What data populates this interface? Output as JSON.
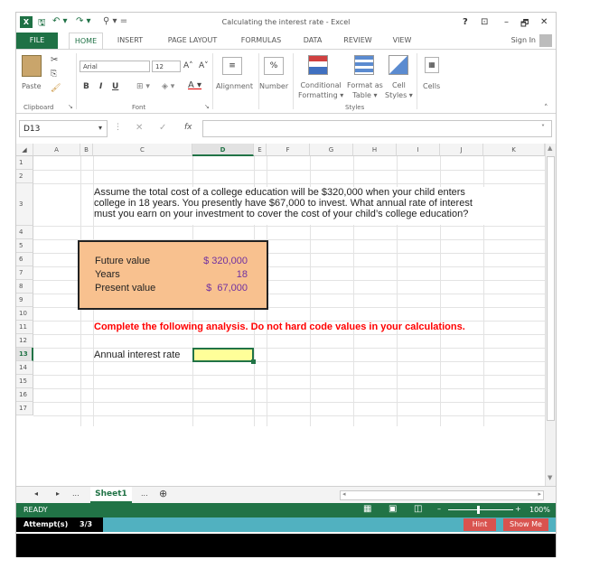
{
  "window": {
    "title": "Calculating the interest rate - Excel",
    "help": "?",
    "controls": [
      "⊡",
      "–",
      "🗗",
      "✕"
    ]
  },
  "quick_access": {
    "save": "🖫",
    "undo": "↶ ▾",
    "redo": "↷ ▾",
    "extra": "⚲ ▾ ="
  },
  "tabs": [
    "FILE",
    "HOME",
    "INSERT",
    "PAGE LAYOUT",
    "FORMULAS",
    "DATA",
    "REVIEW",
    "VIEW"
  ],
  "active_tab": "HOME",
  "sign_in": "Sign In",
  "ribbon": {
    "clipboard": {
      "paste": "Paste",
      "group": "Clipboard"
    },
    "font": {
      "name": "Arial",
      "size": "12",
      "bold": "B",
      "italic": "I",
      "underline": "U",
      "grow": "A˄",
      "shrink": "A˅",
      "group": "Font"
    },
    "alignment": {
      "label": "Alignment"
    },
    "number": {
      "label": "Number",
      "symbol": "%"
    },
    "styles": {
      "conditional": "Conditional\nFormatting ▾",
      "format_table": "Format as\nTable ▾",
      "cell_styles": "Cell\nStyles ▾",
      "group": "Styles"
    },
    "cells": {
      "label": "Cells"
    }
  },
  "formula_bar": {
    "name_box": "D13",
    "fx": "fx",
    "value": ""
  },
  "columns": [
    "A",
    "B",
    "C",
    "D",
    "E",
    "F",
    "G",
    "H",
    "I",
    "J",
    "K"
  ],
  "rows": [
    "1",
    "2",
    "3",
    "4",
    "5",
    "6",
    "7",
    "8",
    "9",
    "10",
    "11",
    "12",
    "13",
    "14",
    "15",
    "16",
    "17"
  ],
  "active_row": "13",
  "active_col": "D",
  "sheet": {
    "intro_line1": "Assume the total cost of a college education will be $320,000 when your child enters",
    "intro_line2": "college in 18 years. You presently have $67,000 to invest. What annual rate of interest",
    "intro_line3": "must you earn on your investment to cover the cost of your child’s college education?",
    "inputs": [
      {
        "label": "Future value",
        "value": "$ 320,000"
      },
      {
        "label": "Years",
        "value": "18"
      },
      {
        "label": "Present value",
        "value": "$  67,000"
      }
    ],
    "instruction": "Complete the following analysis. Do not hard code values in your calculations.",
    "answer_label": "Annual interest rate",
    "answer_value": ""
  },
  "sheet_tabs": {
    "active": "Sheet1",
    "ellipsis": "...",
    "add": "⊕"
  },
  "status": {
    "ready": "READY",
    "zoom": "100%"
  },
  "attempts": {
    "label": "Attempt(s)",
    "value": "3/3",
    "hint": "Hint",
    "show_me": "Show Me"
  },
  "colors": {
    "excel_green": "#217346",
    "input_box": "#F8C18F",
    "answer_fill": "#FFFF99",
    "instruction_red": "#FF0000",
    "value_purple": "#7030A0",
    "attempt_bar": "#51B1C0"
  }
}
